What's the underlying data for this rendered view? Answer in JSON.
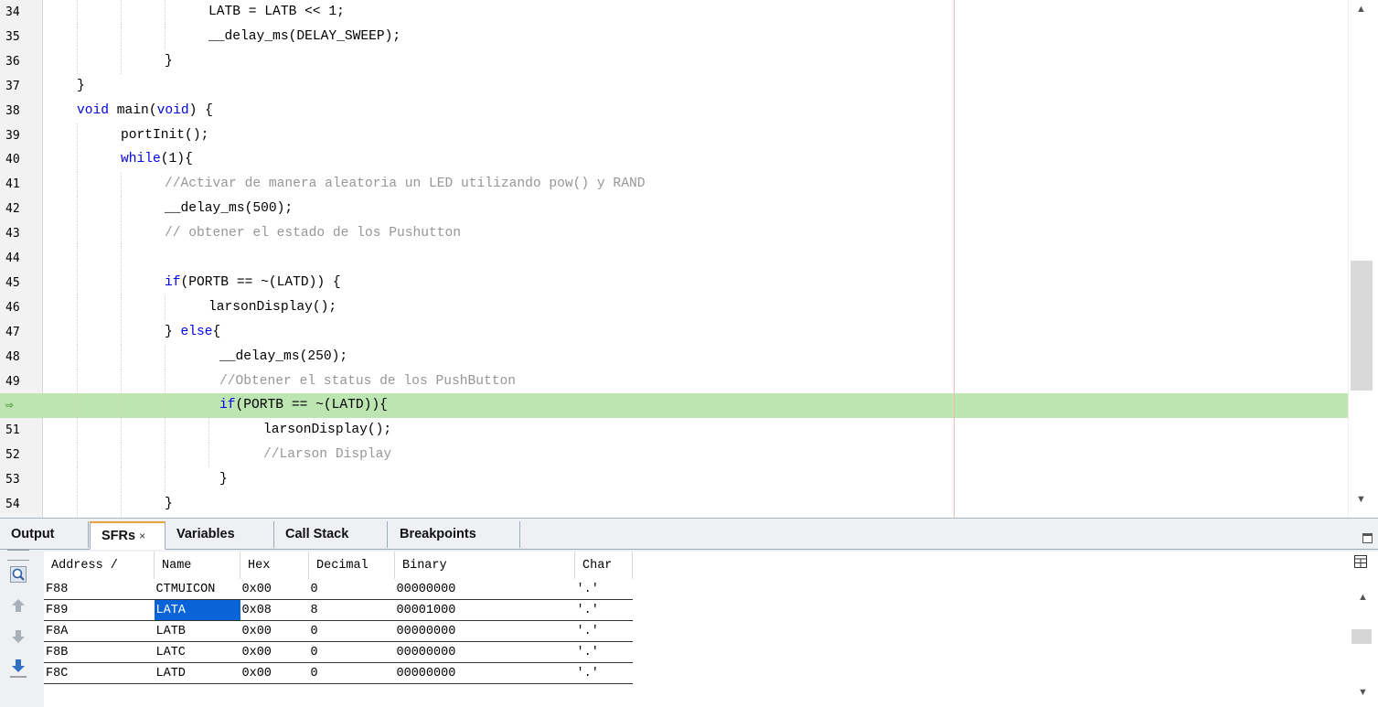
{
  "editor": {
    "lines": [
      {
        "num": "34",
        "indent": 3,
        "tokens": [
          {
            "t": "LATB = LATB << 1;",
            "c": ""
          }
        ]
      },
      {
        "num": "35",
        "indent": 3,
        "tokens": [
          {
            "t": "__delay_ms(DELAY_SWEEP);",
            "c": ""
          }
        ]
      },
      {
        "num": "36",
        "indent": 2,
        "tokens": [
          {
            "t": "}",
            "c": ""
          }
        ]
      },
      {
        "num": "37",
        "indent": 0,
        "tokens": [
          {
            "t": "}",
            "c": ""
          }
        ]
      },
      {
        "num": "38",
        "indent": 0,
        "tokens": [
          {
            "t": "void",
            "c": "kw"
          },
          {
            "t": " main(",
            "c": ""
          },
          {
            "t": "void",
            "c": "kw"
          },
          {
            "t": ") {",
            "c": ""
          }
        ]
      },
      {
        "num": "39",
        "indent": 1,
        "tokens": [
          {
            "t": "portInit();",
            "c": ""
          }
        ]
      },
      {
        "num": "40",
        "indent": 1,
        "tokens": [
          {
            "t": "while",
            "c": "kw"
          },
          {
            "t": "(1){",
            "c": ""
          }
        ]
      },
      {
        "num": "41",
        "indent": 2,
        "tokens": [
          {
            "t": "//Activar de manera aleatoria un LED utilizando pow() y RAND",
            "c": "cm"
          }
        ]
      },
      {
        "num": "42",
        "indent": 2,
        "tokens": [
          {
            "t": "__delay_ms(500);",
            "c": ""
          }
        ]
      },
      {
        "num": "43",
        "indent": 2,
        "tokens": [
          {
            "t": "// obtener el estado de los Pushutton",
            "c": "cm"
          }
        ]
      },
      {
        "num": "44",
        "indent": 2,
        "tokens": []
      },
      {
        "num": "45",
        "indent": 2,
        "tokens": [
          {
            "t": "if",
            "c": "kw"
          },
          {
            "t": "(PORTB == ~(LATD)) {",
            "c": ""
          }
        ]
      },
      {
        "num": "46",
        "indent": 3,
        "tokens": [
          {
            "t": "larsonDisplay();",
            "c": ""
          }
        ]
      },
      {
        "num": "47",
        "indent": 2,
        "tokens": [
          {
            "t": "} ",
            "c": ""
          },
          {
            "t": "else",
            "c": "kw"
          },
          {
            "t": "{",
            "c": ""
          }
        ]
      },
      {
        "num": "48",
        "indent": 3.25,
        "tokens": [
          {
            "t": "__delay_ms(250);",
            "c": ""
          }
        ]
      },
      {
        "num": "49",
        "indent": 3.25,
        "tokens": [
          {
            "t": "//Obtener el status de los PushButton",
            "c": "cm"
          }
        ]
      },
      {
        "num": "⇨",
        "indent": 3.25,
        "current": true,
        "tokens": [
          {
            "t": "if",
            "c": "kw"
          },
          {
            "t": "(PORTB == ~(LATD)){",
            "c": ""
          }
        ]
      },
      {
        "num": "51",
        "indent": 4.25,
        "tokens": [
          {
            "t": "larsonDisplay();",
            "c": ""
          }
        ]
      },
      {
        "num": "52",
        "indent": 4.25,
        "tokens": [
          {
            "t": "//Larson Display",
            "c": "cm"
          }
        ]
      },
      {
        "num": "53",
        "indent": 3.25,
        "tokens": [
          {
            "t": "}",
            "c": ""
          }
        ]
      },
      {
        "num": "54",
        "indent": 2,
        "tokens": [
          {
            "t": "}",
            "c": ""
          }
        ]
      }
    ]
  },
  "panel": {
    "tabs": [
      {
        "label": "Output",
        "active": false
      },
      {
        "label": "SFRs",
        "active": true,
        "close": "×"
      },
      {
        "label": "Variables",
        "active": false
      },
      {
        "label": "Call Stack",
        "active": false
      },
      {
        "label": "Breakpoints",
        "active": false
      }
    ],
    "table": {
      "columns": [
        "Address /",
        "Name",
        "Hex",
        "Decimal",
        "Binary",
        "Char"
      ],
      "rows": [
        [
          "F88",
          "CTMUICON",
          "0x00",
          "0",
          "00000000",
          "'.'"
        ],
        [
          "F89",
          "LATA",
          "0x08",
          "8",
          "00001000",
          "'.'"
        ],
        [
          "F8A",
          "LATB",
          "0x00",
          "0",
          "00000000",
          "'.'"
        ],
        [
          "F8B",
          "LATC",
          "0x00",
          "0",
          "00000000",
          "'.'"
        ],
        [
          "F8C",
          "LATD",
          "0x00",
          "0",
          "00000000",
          "'.'"
        ]
      ],
      "selected": {
        "row": 1,
        "col": 1
      }
    }
  },
  "icons": {
    "editor_scroll_up": "chevron-up-icon",
    "editor_scroll_down": "chevron-down-icon",
    "tools": [
      "magnifier-icon",
      "up-arrow-icon",
      "down-arrow-icon",
      "step-down-icon"
    ]
  },
  "colors": {
    "current_line": "#bde5b1",
    "keyword": "#0000e6",
    "comment": "#969696",
    "selection": "#0a64d8",
    "active_tab_accent": "#e6a23c"
  }
}
